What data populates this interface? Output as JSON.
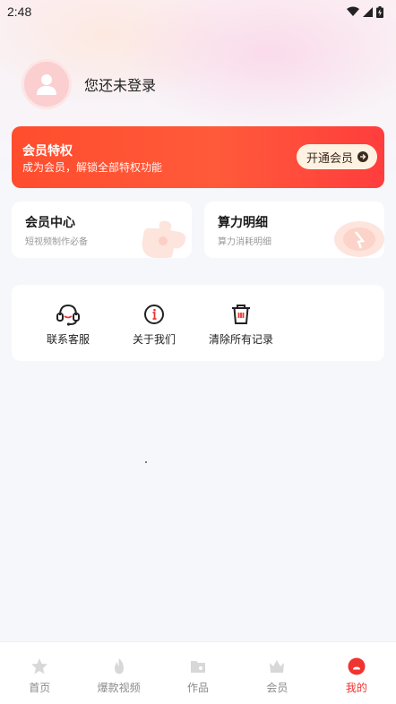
{
  "status_bar": {
    "time": "2:48"
  },
  "profile": {
    "login_text": "您还未登录"
  },
  "vip_banner": {
    "title": "会员特权",
    "subtitle": "成为会员，解锁全部特权功能",
    "button_label": "开通会员"
  },
  "cards": [
    {
      "title": "会员中心",
      "subtitle": "短视频制作必备"
    },
    {
      "title": "算力明细",
      "subtitle": "算力消耗明细"
    }
  ],
  "tools": [
    {
      "label": "联系客服",
      "icon": "headset-icon"
    },
    {
      "label": "关于我们",
      "icon": "info-icon"
    },
    {
      "label": "清除所有记录",
      "icon": "trash-icon"
    }
  ],
  "tabbar": {
    "items": [
      {
        "label": "首页",
        "icon": "home-icon"
      },
      {
        "label": "爆款视频",
        "icon": "flame-icon"
      },
      {
        "label": "作品",
        "icon": "folder-icon"
      },
      {
        "label": "会员",
        "icon": "crown-icon"
      },
      {
        "label": "我的",
        "icon": "profile-icon"
      }
    ],
    "active_index": 4
  },
  "colors": {
    "accent": "#f0342f",
    "banner_start": "#ff4d2e",
    "banner_end": "#ff3d3d"
  }
}
